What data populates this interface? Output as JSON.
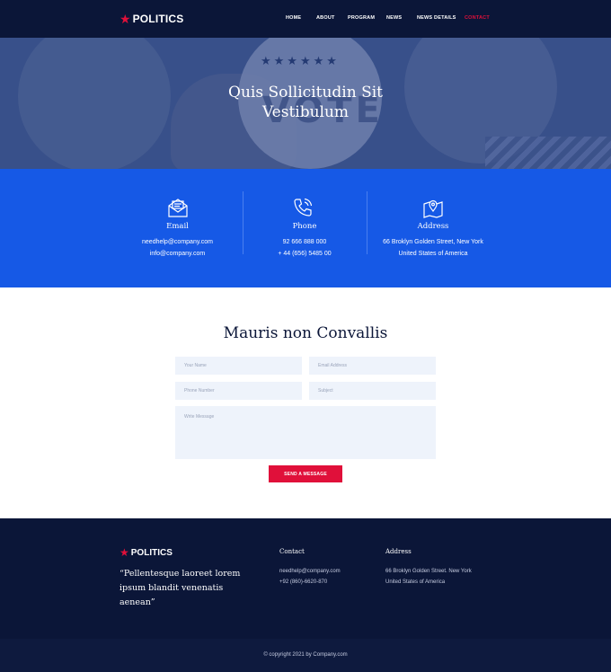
{
  "brand": {
    "name": "POLITICS"
  },
  "nav": {
    "items": [
      "HOME",
      "ABOUT",
      "PROGRAM",
      "NEWS",
      "NEWS DETAILS",
      "CONTACT"
    ],
    "active": "CONTACT"
  },
  "hero": {
    "title_line1": "Quis Sollicitudin Sit",
    "title_line2": "Vestibulum",
    "badge_text": "VOTE"
  },
  "info": {
    "email": {
      "title": "Email",
      "line1": "needhelp@company.com",
      "line2": "info@company.com"
    },
    "phone": {
      "title": "Phone",
      "line1": "92 666 888 000",
      "line2": "+ 44 (656) 5485 00"
    },
    "address": {
      "title": "Address",
      "line1": "66 Broklyn Golden Street, New York",
      "line2": "United States of America"
    }
  },
  "form": {
    "title": "Mauris non Convallis",
    "name_placeholder": "Your Name",
    "email_placeholder": "Email Address",
    "phone_placeholder": "Phone Number",
    "subject_placeholder": "Subject",
    "message_placeholder": "Write Message",
    "submit_label": "SEND A MESSAGE"
  },
  "footer": {
    "quote": "“Pellentesque laoreet lorem ipsum blandit venenatis aenean”",
    "contact_title": "Contact",
    "contact_email": "needhelp@company.com",
    "contact_phone": "+92 (860)-6620-870",
    "address_title": "Address",
    "address_line1": "66 Broklyn Golden Street. New York",
    "address_line2": "United States of America",
    "copyright": "© copyright 2021 by Company.com"
  },
  "colors": {
    "navy": "#0b1638",
    "blue": "#1659e6",
    "accent": "#e0103a",
    "field": "#eef3fb"
  },
  "icons": {
    "logo": "star-icon",
    "email": "envelope-icon",
    "phone": "phone-icon",
    "address": "map-pin-icon"
  }
}
